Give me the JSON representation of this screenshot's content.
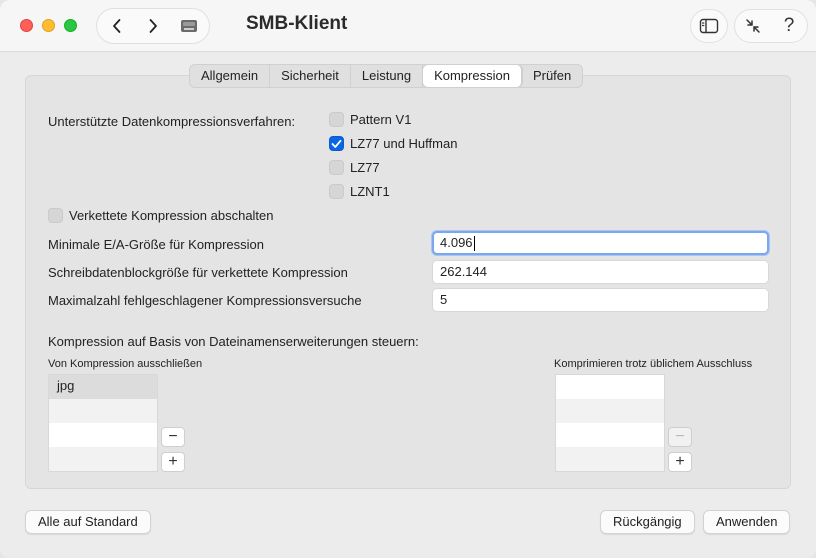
{
  "window": {
    "title": "SMB-Klient"
  },
  "tabs": [
    "Allgemein",
    "Sicherheit",
    "Leistung",
    "Kompression",
    "Prüfen"
  ],
  "active_tab": "Kompression",
  "compression": {
    "methods_label": "Unterstützte Datenkompressionsverfahren:",
    "methods": [
      {
        "label": "Pattern V1",
        "checked": false
      },
      {
        "label": "LZ77 und Huffman",
        "checked": true
      },
      {
        "label": "LZ77",
        "checked": false
      },
      {
        "label": "LZNT1",
        "checked": false
      }
    ],
    "disable_chained_label": "Verkettete Kompression abschalten",
    "disable_chained_checked": false,
    "fields": [
      {
        "label": "Minimale E/A-Größe für Kompression",
        "value": "4.096"
      },
      {
        "label": "Schreibdatenblockgröße für verkettete Kompression",
        "value": "262.144"
      },
      {
        "label": "Maximalzahl fehlgeschlagener Kompressionsversuche",
        "value": "5"
      }
    ],
    "extensions_label": "Kompression auf Basis von Dateinamenserweiterungen steuern:",
    "exclude_label": "Von Kompression ausschließen",
    "exclude_items": [
      "jpg"
    ],
    "include_label": "Komprimieren trotz üblichem Ausschluss",
    "include_items": []
  },
  "buttons": {
    "reset_all": "Alle auf Standard",
    "undo": "Rückgängig",
    "apply": "Anwenden",
    "minus": "−",
    "plus": "+"
  },
  "icons": {
    "back": "chevron-left-icon",
    "forward": "chevron-right-icon",
    "disk": "network-drive-icon",
    "sidebar": "sidebar-icon",
    "shrink": "arrows-inward-icon",
    "help": "?"
  }
}
